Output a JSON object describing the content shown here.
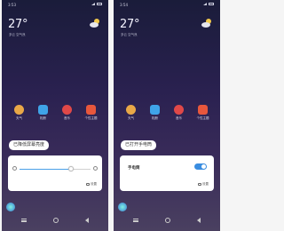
{
  "screens": [
    {
      "status_time": "3:53",
      "weather": {
        "temperature": "27°",
        "description": "多云 空气良"
      },
      "apps": [
        {
          "label": "天气",
          "icon": "weather-icon",
          "color": "#e9a847"
        },
        {
          "label": "相册",
          "icon": "gallery-icon",
          "color": "#3fa3e8"
        },
        {
          "label": "音乐",
          "icon": "music-icon",
          "color": "#e04848"
        },
        {
          "label": "个性主题",
          "icon": "theme-icon",
          "color": "#e8573c"
        }
      ],
      "toast": "已降低屏幕亮度",
      "panel_type": "brightness",
      "brightness_level": 0.72,
      "settings_label": "设置"
    },
    {
      "status_time": "3:54",
      "weather": {
        "temperature": "27°",
        "description": "多云 空气良"
      },
      "apps": [
        {
          "label": "天气",
          "icon": "weather-icon",
          "color": "#e9a847"
        },
        {
          "label": "相册",
          "icon": "gallery-icon",
          "color": "#3fa3e8"
        },
        {
          "label": "音乐",
          "icon": "music-icon",
          "color": "#e04848"
        },
        {
          "label": "个性主题",
          "icon": "theme-icon",
          "color": "#e8573c"
        }
      ],
      "toast": "已打开手电筒",
      "panel_type": "flashlight",
      "flashlight_label": "手电筒",
      "flashlight_on": true,
      "settings_label": "设置"
    }
  ]
}
